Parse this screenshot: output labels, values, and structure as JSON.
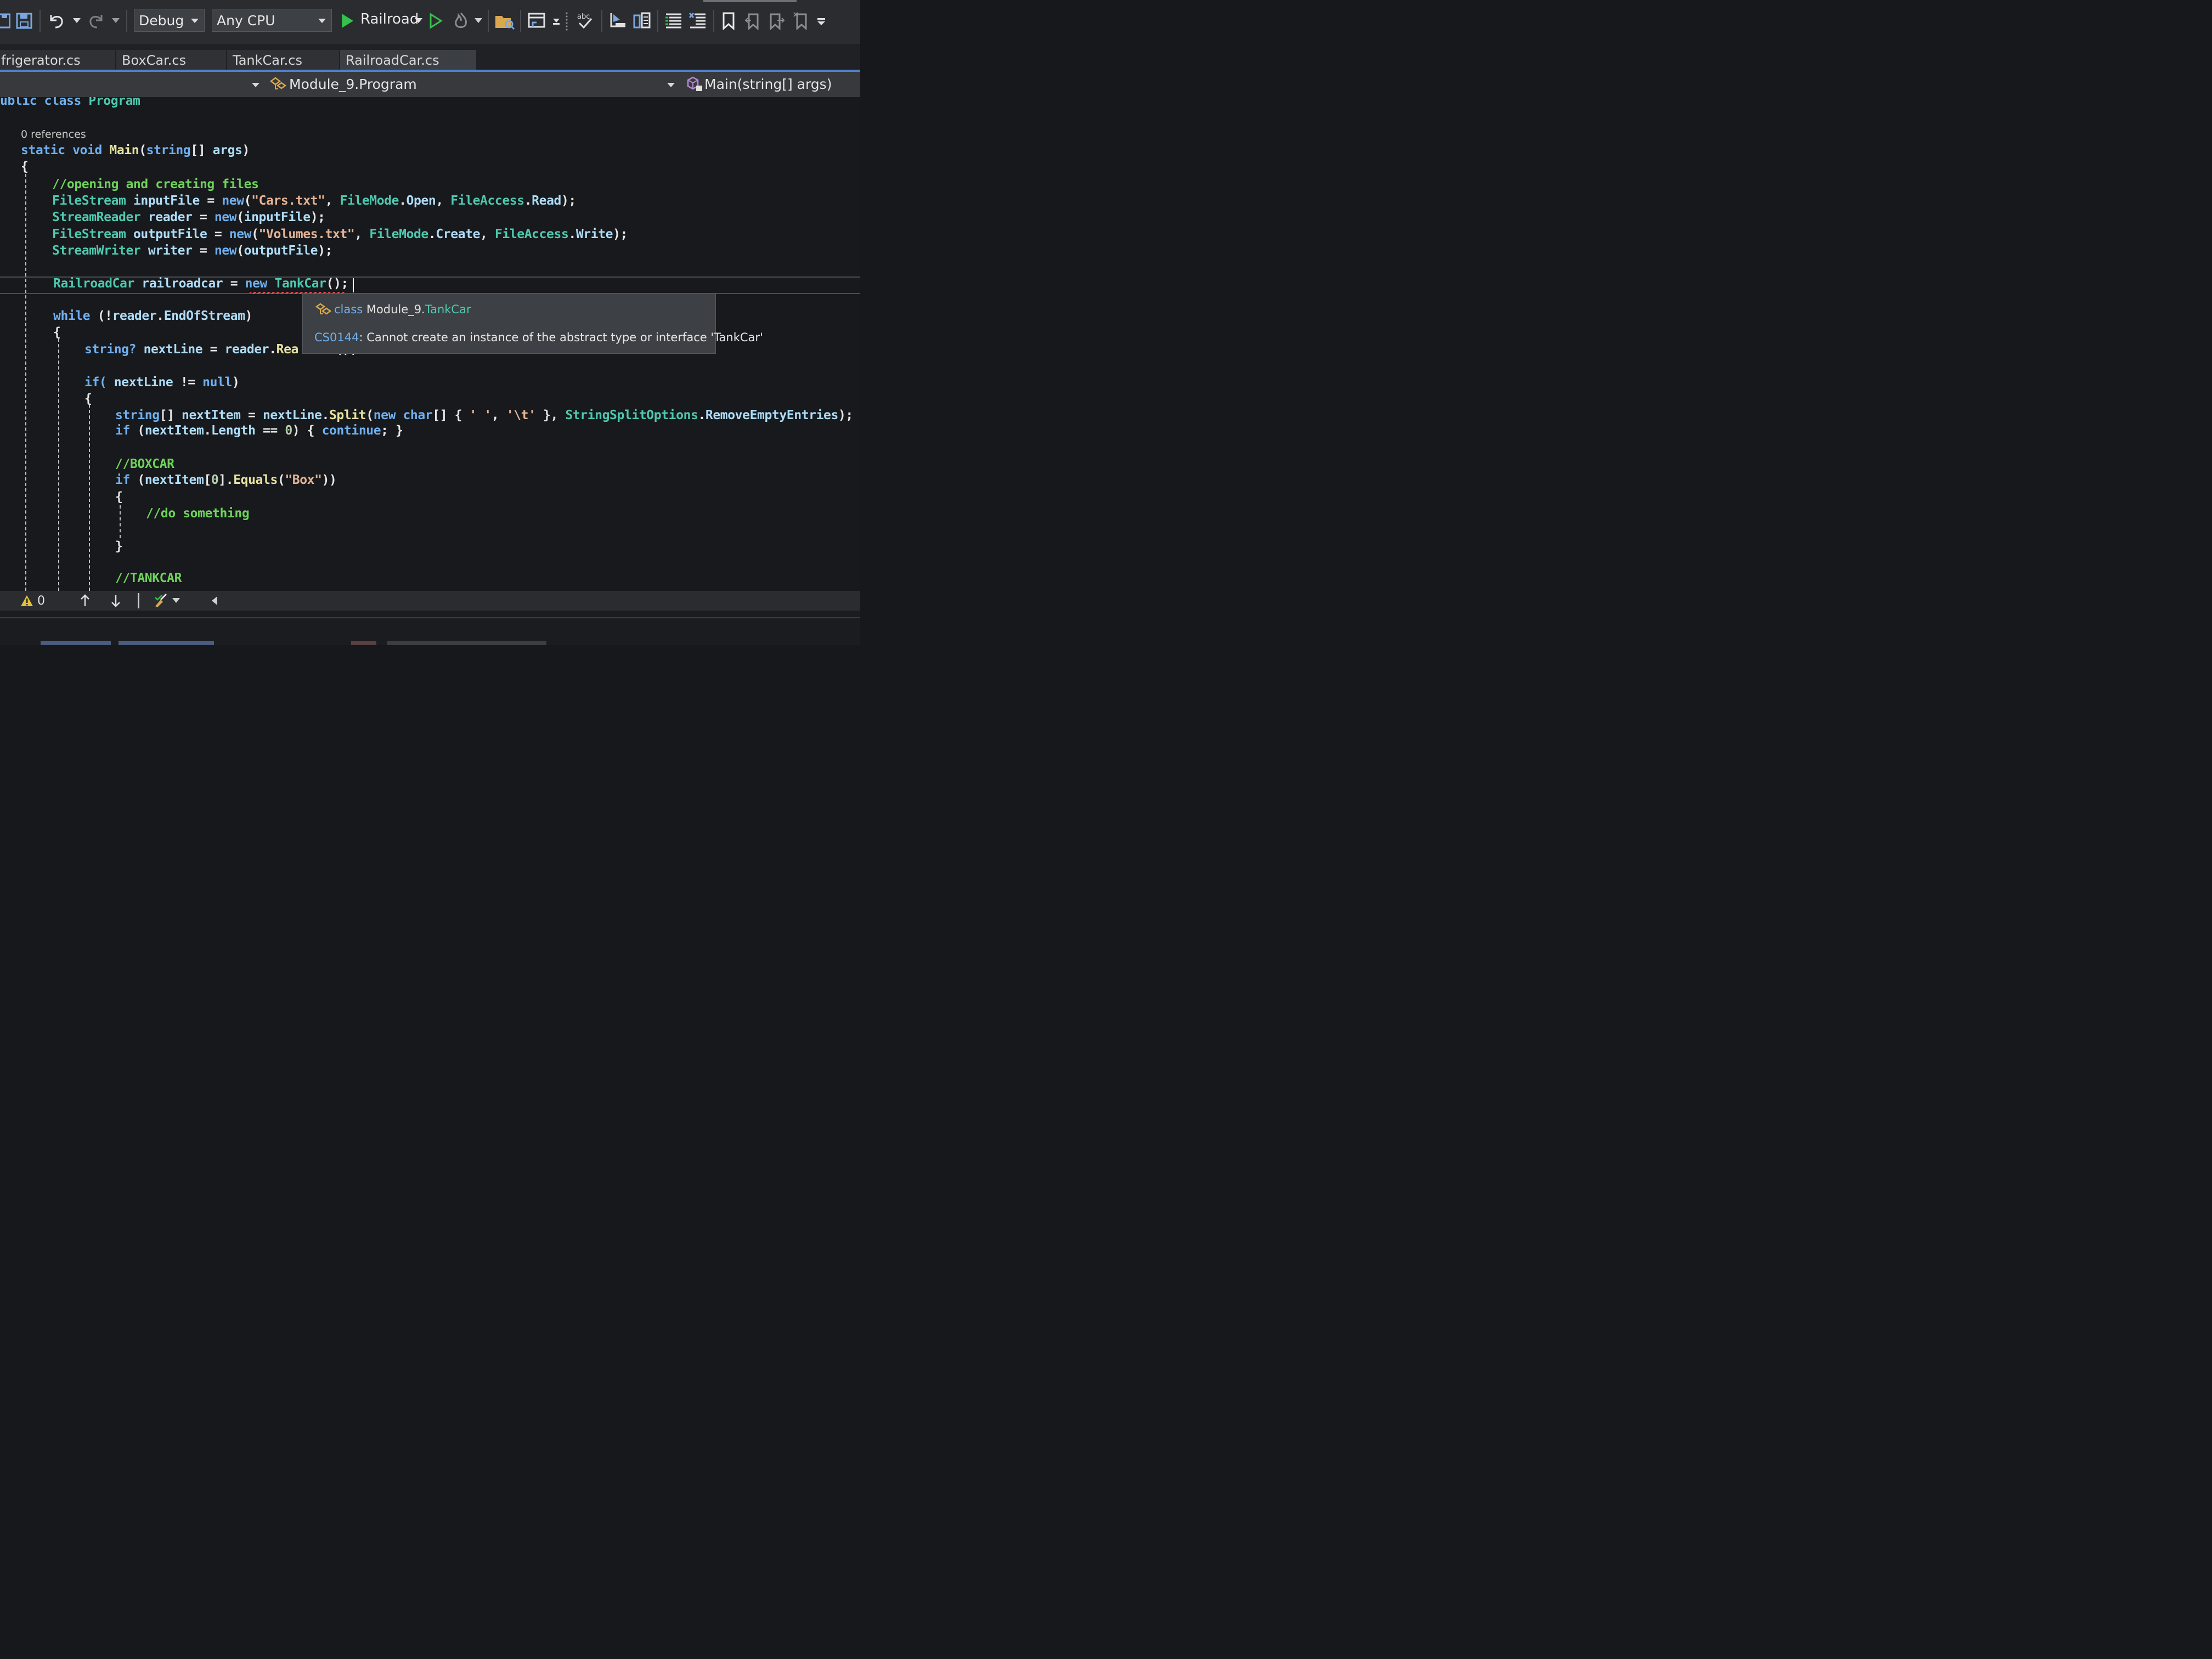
{
  "toolbar": {
    "config_combo": "Debug",
    "platform_combo": "Any CPU",
    "run_label": "Railroad"
  },
  "tabs": [
    {
      "label": "frigerator.cs"
    },
    {
      "label": "BoxCar.cs"
    },
    {
      "label": "TankCar.cs"
    },
    {
      "label": "RailroadCar.cs"
    }
  ],
  "navbar": {
    "type_scope": "Module_9.Program",
    "member_scope": "Main(string[] args)"
  },
  "editor": {
    "class_decl_kw": "ublic class",
    "class_decl_name": "Program",
    "references_lens": "0 references",
    "main_sig": {
      "kw1": "static",
      "kw2": "void",
      "name": "Main",
      "param_type": "string",
      "param_name": "args"
    },
    "comment_files": "//opening and creating files",
    "lines": {
      "input_file": {
        "type": "FileStream",
        "var": "inputFile",
        "new": "new",
        "str": "\"Cars.txt\"",
        "a1": "FileMode",
        "a2": "Open",
        "a3": "FileAccess",
        "a4": "Read"
      },
      "reader": {
        "type": "StreamReader",
        "var": "reader",
        "new": "new",
        "arg": "inputFile"
      },
      "output_file": {
        "type": "FileStream",
        "var": "outputFile",
        "new": "new",
        "str": "\"Volumes.txt\"",
        "a1": "FileMode",
        "a2": "Create",
        "a3": "FileAccess",
        "a4": "Write"
      },
      "writer": {
        "type": "StreamWriter",
        "var": "writer",
        "new": "new",
        "arg": "outputFile"
      },
      "railroadcar": {
        "type": "RailroadCar",
        "var": "railroadcar",
        "new": "new",
        "ctor": "TankCar"
      },
      "while": {
        "kw": "while",
        "obj": "reader",
        "prop": "EndOfStream"
      },
      "next_line": {
        "type": "string?",
        "var": "nextLine",
        "obj": "reader",
        "call": "Rea",
        "tail": "     ();"
      },
      "if_null": {
        "kw": "if(",
        "var": "nextLine",
        "null": "null"
      },
      "split": {
        "type": "string",
        "var": "nextItem",
        "obj": "nextLine",
        "fn": "Split",
        "new": "new",
        "ch": "char",
        "c1": "' '",
        "c2": "'\\t'",
        "enum": "StringSplitOptions",
        "member": "RemoveEmptyEntries"
      },
      "len_check": {
        "kw": "if",
        "obj": "nextItem",
        "prop": "Length",
        "num": "0",
        "cont": "continue"
      },
      "comment_boxcar": "//BOXCAR",
      "box_if": {
        "kw": "if",
        "obj": "nextItem",
        "num": "0",
        "fn": "Equals",
        "str": "\"Box\""
      },
      "comment_do": "//do something",
      "comment_tankcar": "//TANKCAR"
    }
  },
  "tooltip": {
    "kind": "class",
    "ns": "Module_9.",
    "type": "TankCar",
    "error_code": "CS0144",
    "error_text": ": Cannot create an instance of the abstract type or interface 'TankCar'"
  },
  "statusbar": {
    "warnings_count": "0"
  }
}
